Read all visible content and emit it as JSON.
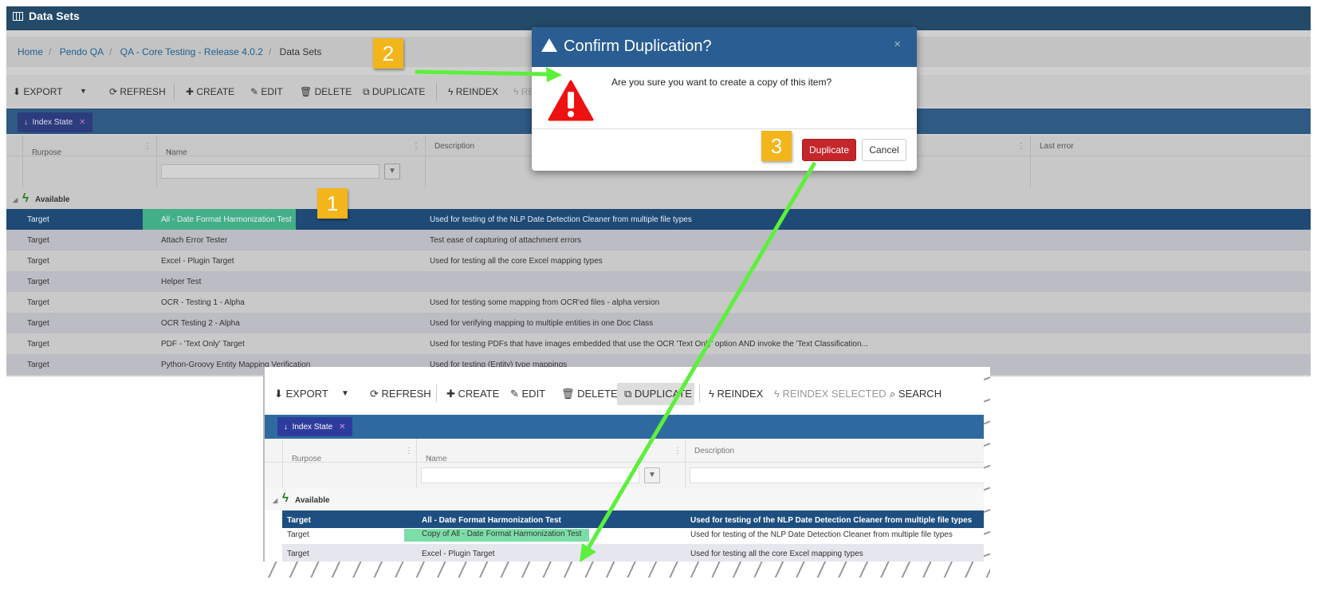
{
  "top": {
    "title": "Data Sets",
    "breadcrumb": [
      "Home",
      "Pendo QA",
      "QA - Core Testing - Release 4.0.2",
      "Data Sets"
    ],
    "toolbar": {
      "export": "EXPORT",
      "export_caret": "▼",
      "refresh": "REFRESH",
      "create": "CREATE",
      "edit": "EDIT",
      "delete": "DELETE",
      "duplicate": "DUPLICATE",
      "reindex": "REINDEX",
      "reindex_cut": "RE"
    },
    "chip": {
      "label": "Index State",
      "arrow": "↓",
      "close": "✕"
    },
    "columns": {
      "purpose": "Purpose",
      "name": "Name",
      "description": "Description",
      "last_error": "Last error"
    },
    "group": "Available",
    "rows": [
      {
        "purpose": "Target",
        "name": "All - Date Format Harmonization Test",
        "description": "Used for testing of the NLP Date Detection Cleaner from multiple file types"
      },
      {
        "purpose": "Target",
        "name": "Attach Error Tester",
        "description": "Test ease of capturing of attachment errors"
      },
      {
        "purpose": "Target",
        "name": "Excel - Plugin Target",
        "description": "Used for testing all the core Excel mapping types"
      },
      {
        "purpose": "Target",
        "name": "Helper Test",
        "description": ""
      },
      {
        "purpose": "Target",
        "name": "OCR - Testing 1 - Alpha",
        "description": "Used for testing some mapping from OCR'ed files - alpha version"
      },
      {
        "purpose": "Target",
        "name": "OCR Testing 2 - Alpha",
        "description": "Used for verifying mapping to multiple entities in one Doc Class"
      },
      {
        "purpose": "Target",
        "name": "PDF - 'Text Only' Target",
        "description": "Used for testing PDFs that have images embedded that use the OCR 'Text Only' option AND invoke the 'Text Classification..."
      },
      {
        "purpose": "Target",
        "name": "Python-Groovy Entity Mapping Verification",
        "description": "Used for testing (Entity) type mappings"
      }
    ]
  },
  "dialog": {
    "title": "Confirm Duplication?",
    "close": "×",
    "message": "Are you sure you want to create a copy of this item?",
    "primary": "Duplicate",
    "secondary": "Cancel"
  },
  "steps": [
    "1",
    "2",
    "3"
  ],
  "bottom": {
    "toolbar": {
      "export": "EXPORT",
      "export_caret": "▼",
      "refresh": "REFRESH",
      "create": "CREATE",
      "edit": "EDIT",
      "delete": "DELETE",
      "duplicate": "DUPLICATE",
      "reindex": "REINDEX",
      "reindex_selected": "REINDEX SELECTED",
      "search": "SEARCH"
    },
    "chip": {
      "label": "Index State",
      "arrow": "↓",
      "close": "✕"
    },
    "columns": {
      "purpose": "Purpose",
      "name": "Name",
      "description": "Description"
    },
    "group": "Available",
    "rows": [
      {
        "purpose": "Target",
        "name": "All - Date Format Harmonization Test",
        "description": "Used for testing of the NLP Date Detection Cleaner from multiple file types"
      },
      {
        "purpose": "Target",
        "name": "Copy of All - Date Format Harmonization Test",
        "description": "Used for testing of the NLP Date Detection Cleaner from multiple file types"
      },
      {
        "purpose": "Target",
        "name": "Excel - Plugin Target",
        "description": "Used for testing all the core Excel mapping types"
      }
    ]
  },
  "colors": {
    "brand": "#234a68",
    "danger": "#c4262a",
    "step_badge": "#f2b51a",
    "arrow": "#5cf03c",
    "highlight": "#50d28c"
  }
}
